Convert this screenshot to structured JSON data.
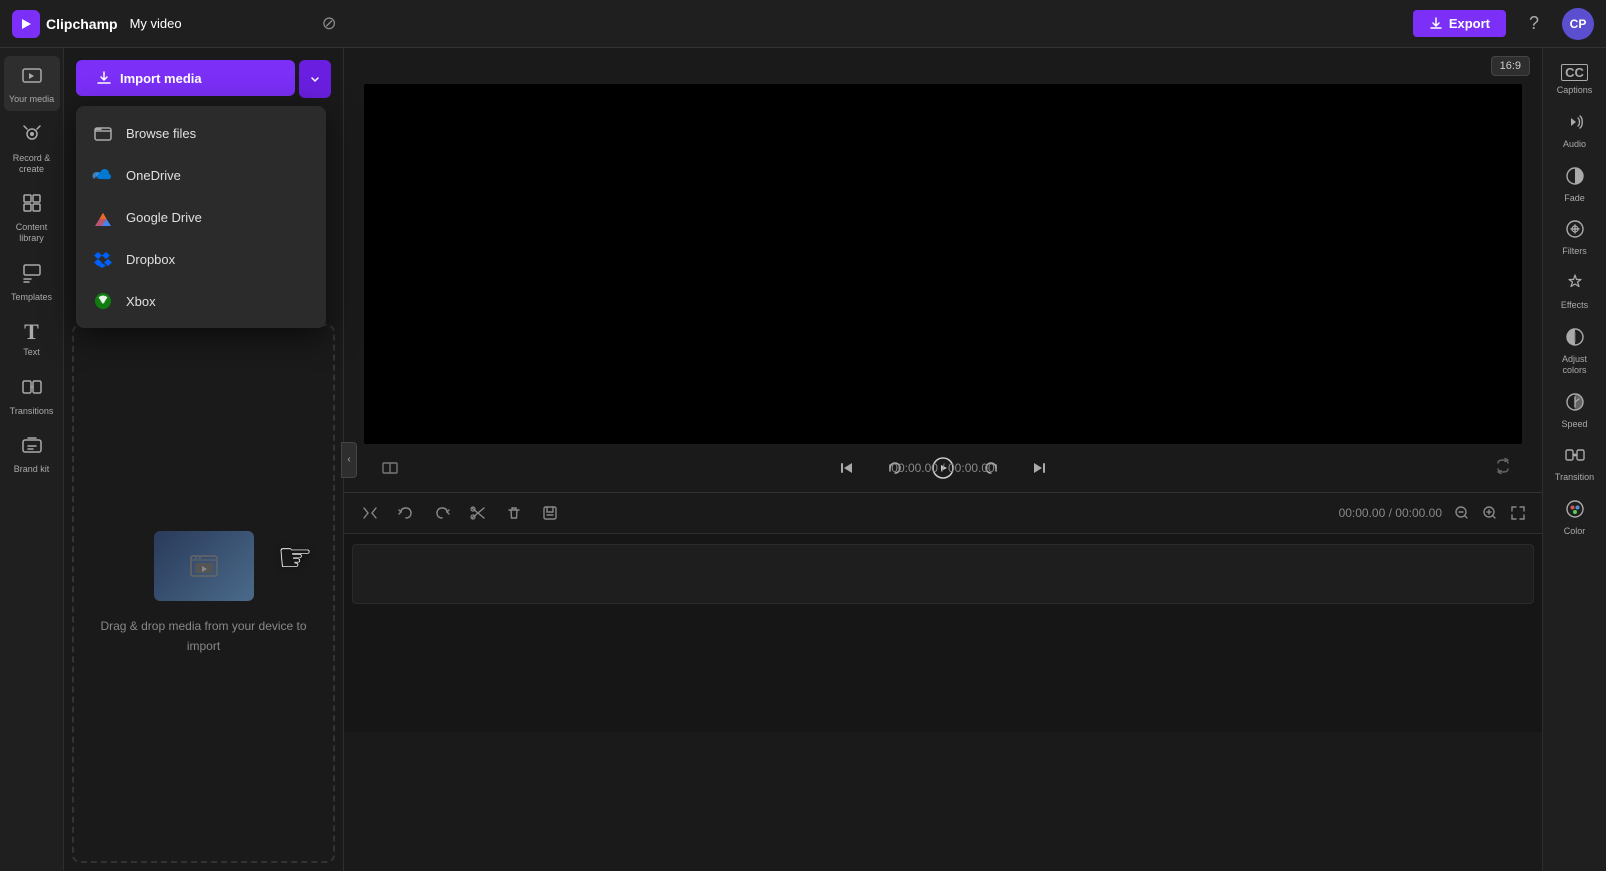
{
  "app": {
    "name": "Clipchamp",
    "title": "My video",
    "logo_char": "▶"
  },
  "topbar": {
    "export_label": "Export",
    "save_icon": "☁",
    "help_icon": "?",
    "avatar_text": "CP"
  },
  "left_nav": {
    "items": [
      {
        "id": "your-media",
        "icon": "🖼",
        "label": "Your media"
      },
      {
        "id": "record-create",
        "icon": "📹",
        "label": "Record & create"
      },
      {
        "id": "content-library",
        "icon": "📚",
        "label": "Content library"
      },
      {
        "id": "templates",
        "icon": "⊞",
        "label": "Templates"
      },
      {
        "id": "text",
        "icon": "T",
        "label": "Text"
      },
      {
        "id": "transitions",
        "icon": "⧉",
        "label": "Transitions"
      },
      {
        "id": "brand-kit",
        "icon": "🏷",
        "label": "Brand kit"
      }
    ]
  },
  "media_panel": {
    "import_btn_label": "Import media",
    "dropdown": {
      "items": [
        {
          "id": "browse-files",
          "icon": "📁",
          "label": "Browse files"
        },
        {
          "id": "onedrive",
          "icon": "onedrive",
          "label": "OneDrive"
        },
        {
          "id": "google-drive",
          "icon": "gdrive",
          "label": "Google Drive"
        },
        {
          "id": "dropbox",
          "icon": "dropbox",
          "label": "Dropbox"
        },
        {
          "id": "xbox",
          "icon": "xbox",
          "label": "Xbox"
        }
      ]
    },
    "drag_drop_text": "Drag & drop media from your device to import"
  },
  "preview": {
    "aspect_ratio": "16:9",
    "time_current": "00:00.00",
    "time_total": "00:00.00",
    "time_separator": " / "
  },
  "timeline": {
    "time_label": "00:00.00 / 00:00.00"
  },
  "right_sidebar": {
    "tools": [
      {
        "id": "captions",
        "icon": "CC",
        "label": "Captions"
      },
      {
        "id": "audio",
        "icon": "🔊",
        "label": "Audio"
      },
      {
        "id": "fade",
        "icon": "◑",
        "label": "Fade"
      },
      {
        "id": "filters",
        "icon": "⊟",
        "label": "Filters"
      },
      {
        "id": "effects",
        "icon": "✦",
        "label": "Effects"
      },
      {
        "id": "adjust-colors",
        "icon": "◐",
        "label": "Adjust colors"
      },
      {
        "id": "speed",
        "icon": "◑",
        "label": "Speed"
      },
      {
        "id": "transition",
        "icon": "⧖",
        "label": "Transition"
      },
      {
        "id": "color",
        "icon": "🎨",
        "label": "Color"
      }
    ]
  },
  "colors": {
    "accent": "#7b2ff7",
    "bg_dark": "#1a1a1a",
    "bg_panel": "#1f1f1f",
    "border": "#2e2e2e",
    "text_muted": "#888888",
    "onedrive_blue": "#0078d4",
    "gdrive_colors": [
      "#4285f4",
      "#ea4335",
      "#fbbc04",
      "#34a853"
    ],
    "dropbox_blue": "#0061ff",
    "xbox_green": "#107c10"
  }
}
